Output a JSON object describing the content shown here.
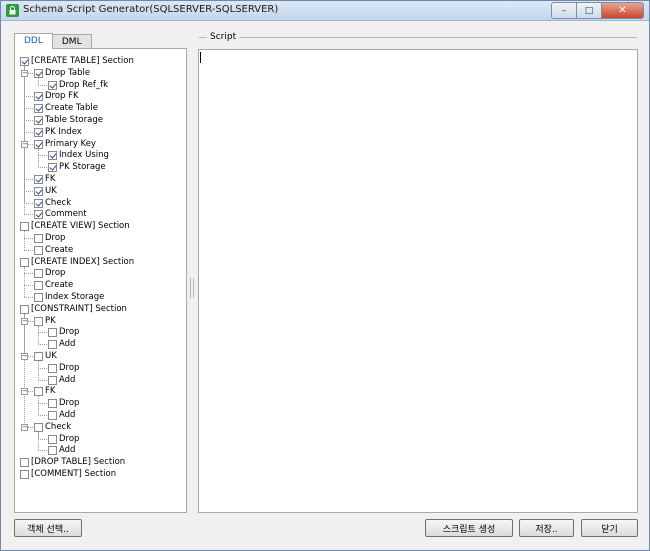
{
  "window": {
    "title": "Schema Script Generator(SQLSERVER-SQLSERVER)",
    "controls": {
      "minimize": "–",
      "maximize": "□",
      "close": "✕"
    }
  },
  "tabs": [
    "DDL",
    "DML"
  ],
  "tree": [
    "[CREATE TABLE] Section",
    "Drop Table",
    "Drop Ref_fk",
    "Drop FK",
    "Create Table",
    "Table Storage",
    "PK Index",
    "Primary Key",
    "Index Using",
    "PK Storage",
    "FK",
    "UK",
    "Check",
    "Comment",
    "[CREATE VIEW] Section",
    "Drop",
    "Create",
    "[CREATE INDEX] Section",
    "Drop",
    "Create",
    "Index Storage",
    "[CONSTRAINT] Section",
    "PK",
    "Drop",
    "Add",
    "UK",
    "Drop",
    "Add",
    "FK",
    "Drop",
    "Add",
    "Check",
    "Drop",
    "Add",
    "[DROP TABLE] Section",
    "[COMMENT] Section"
  ],
  "checked": [
    true,
    true,
    true,
    true,
    true,
    true,
    true,
    true,
    true,
    true,
    true,
    true,
    true,
    true,
    false,
    false,
    false,
    false,
    false,
    false,
    false,
    false,
    false,
    false,
    false,
    false,
    false,
    false,
    false,
    false,
    false,
    false,
    false,
    false,
    false,
    false
  ],
  "script": {
    "label": "Script",
    "content": ""
  },
  "buttons": {
    "select_objects": "객체 선택..",
    "generate_script": "스크립트 생성",
    "save": "저장..",
    "close": "닫기"
  }
}
